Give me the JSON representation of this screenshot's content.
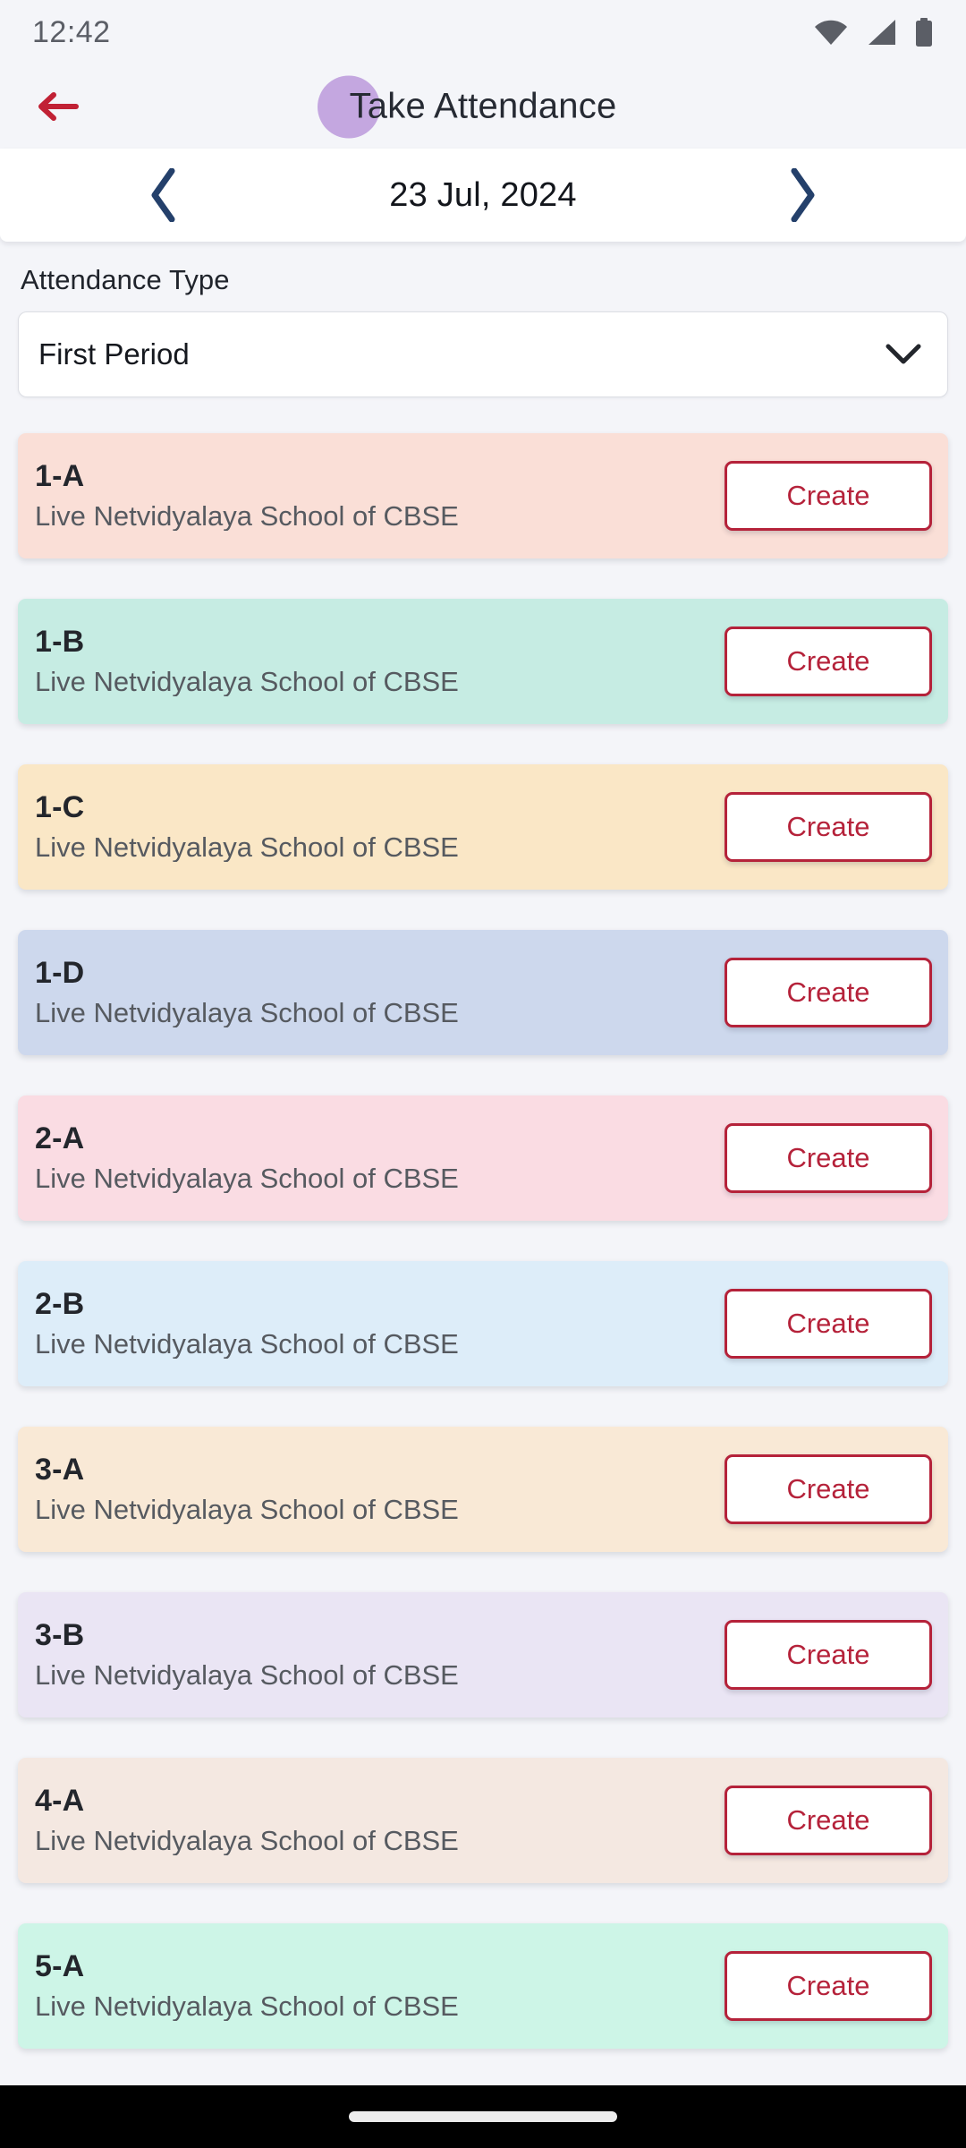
{
  "status_bar": {
    "time": "12:42",
    "icons": [
      "wifi-icon",
      "cellular-signal-icon",
      "battery-icon"
    ]
  },
  "app_bar": {
    "back_icon": "back-arrow-icon",
    "title": "Take Attendance",
    "avatar_color": "#c4a7e0"
  },
  "date_bar": {
    "prev_icon": "chevron-left-icon",
    "date": "23 Jul, 2024",
    "next_icon": "chevron-right-icon"
  },
  "attendance_type": {
    "label": "Attendance Type",
    "selected": "First Period",
    "chevron_icon": "chevron-down-icon"
  },
  "colors": {
    "background": "#f4f5f9",
    "accent_red": "#b5223a",
    "date_arrow": "#24406b",
    "title_text": "#262a33"
  },
  "classes": [
    {
      "name": "1-A",
      "school": "Live Netvidyalaya School of CBSE",
      "bg": "#fadfd7",
      "action": "Create"
    },
    {
      "name": "1-B",
      "school": "Live Netvidyalaya School of CBSE",
      "bg": "#c6ece3",
      "action": "Create"
    },
    {
      "name": "1-C",
      "school": "Live Netvidyalaya School of CBSE",
      "bg": "#fae7c6",
      "action": "Create"
    },
    {
      "name": "1-D",
      "school": "Live Netvidyalaya School of CBSE",
      "bg": "#cdd8ed",
      "action": "Create"
    },
    {
      "name": "2-A",
      "school": "Live Netvidyalaya School of CBSE",
      "bg": "#fadce3",
      "action": "Create"
    },
    {
      "name": "2-B",
      "school": "Live Netvidyalaya School of CBSE",
      "bg": "#ddedf9",
      "action": "Create"
    },
    {
      "name": "3-A",
      "school": "Live Netvidyalaya School of CBSE",
      "bg": "#f9e9d6",
      "action": "Create"
    },
    {
      "name": "3-B",
      "school": "Live Netvidyalaya School of CBSE",
      "bg": "#eae5f4",
      "action": "Create"
    },
    {
      "name": "4-A",
      "school": "Live Netvidyalaya School of CBSE",
      "bg": "#f4e8e1",
      "action": "Create"
    },
    {
      "name": "5-A",
      "school": "Live Netvidyalaya School of CBSE",
      "bg": "#cdf5e7",
      "action": "Create"
    }
  ],
  "gesture_bar": {
    "handle": "home-indicator"
  }
}
